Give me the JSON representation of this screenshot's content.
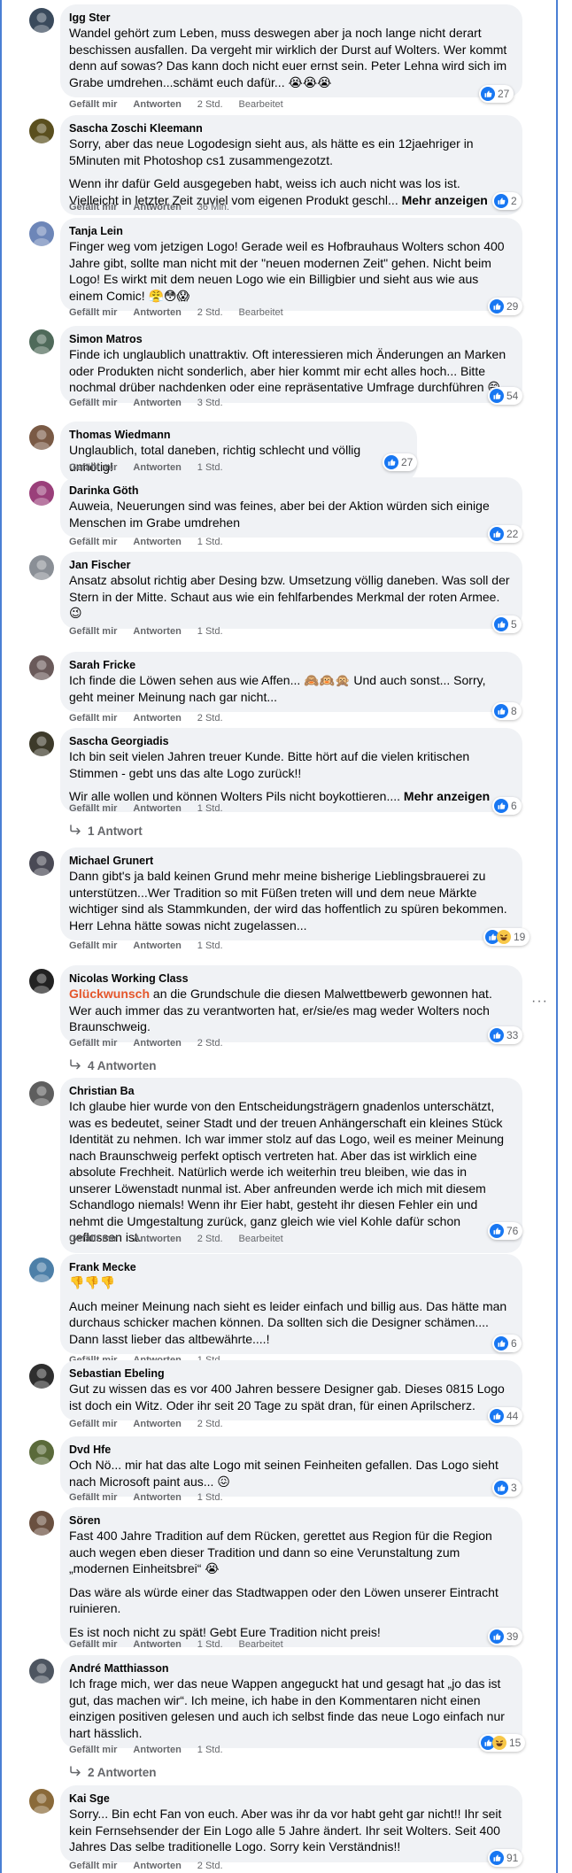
{
  "labels": {
    "like": "Gefällt mir",
    "reply": "Antworten",
    "edited": "Bearbeitet",
    "show_more": "Mehr anzeigen"
  },
  "comments": [
    {
      "name": "Igg Ster",
      "text": [
        "Wandel gehört zum Leben, muss deswegen aber ja noch lange nicht derart beschissen ausfallen. Da vergeht mir wirklich der Durst auf Wolters. Wer kommt denn auf sowas? Das kann doch nicht euer ernst sein. Peter Lehna wird sich im Grabe umdrehen...schämt euch dafür... 😭😭😭"
      ],
      "time": "2 Std.",
      "edited": true,
      "reactions": {
        "icons": [
          "like"
        ],
        "count": "27"
      }
    },
    {
      "name": "Sascha Zoschi Kleemann",
      "text": [
        "Sorry, aber das neue Logodesign sieht aus, als hätte es ein 12jaehriger in 5Minuten mit Photoshop cs1 zusammengezotzt.",
        "Wenn ihr dafür Geld ausgegeben habt, weiss ich auch nicht was los ist. Vielleicht in letzter Zeit zuviel vom eigenen Produkt geschl..."
      ],
      "has_more": true,
      "time": "36 Min.",
      "reactions": {
        "icons": [
          "like"
        ],
        "count": "2"
      }
    },
    {
      "name": "Tanja Lein",
      "text": [
        "Finger weg vom jetzigen Logo! Gerade weil es Hofbrauhaus Wolters schon 400 Jahre gibt, sollte man nicht mit der \"neuen modernen Zeit\" gehen. Nicht beim Logo! Es wirkt mit dem neuen Logo wie ein Billigbier und sieht aus wie aus einem Comic! 😤😳😱"
      ],
      "time": "2 Std.",
      "edited": true,
      "reactions": {
        "icons": [
          "like"
        ],
        "count": "29"
      }
    },
    {
      "name": "Simon Matros",
      "text": [
        "Finde ich unglaublich unattraktiv. Oft interessieren mich Änderungen an Marken oder Produkten nicht sonderlich, aber hier kommt mir echt alles hoch... Bitte nochmal drüber nachdenken oder eine repräsentative Umfrage durchführen 😄"
      ],
      "time": "3 Std.",
      "reactions": {
        "icons": [
          "like"
        ],
        "count": "54"
      }
    },
    {
      "name": "Thomas Wiedmann",
      "text": [
        "Unglaublich, total daneben, richtig schlecht und völlig unnötig!"
      ],
      "time": "1 Std.",
      "reactions": {
        "icons": [
          "like"
        ],
        "count": "27"
      }
    },
    {
      "name": "Darinka Göth",
      "text": [
        "Auweia, Neuerungen sind was feines, aber bei der Aktion würden sich einige Menschen im Grabe umdrehen"
      ],
      "time": "1 Std.",
      "reactions": {
        "icons": [
          "like"
        ],
        "count": "22"
      }
    },
    {
      "name": "Jan Fischer",
      "text": [
        "Ansatz absolut richtig aber Desing bzw. Umsetzung völlig daneben. Was soll der Stern in der Mitte. Schaut aus wie ein fehlfarbendes Merkmal der roten Armee. 😉"
      ],
      "time": "1 Std.",
      "reactions": {
        "icons": [
          "like"
        ],
        "count": "5"
      }
    },
    {
      "name": "Sarah Fricke",
      "text": [
        "Ich finde die Löwen sehen aus wie Affen... 🙈🙉🙊 Und auch sonst... Sorry, geht meiner Meinung nach gar nicht..."
      ],
      "time": "2 Std.",
      "reactions": {
        "icons": [
          "like"
        ],
        "count": "8"
      }
    },
    {
      "name": "Sascha Georgiadis",
      "text": [
        "Ich bin seit vielen Jahren treuer Kunde. Bitte hört auf die vielen kritischen Stimmen - gebt uns das alte Logo zurück!!",
        "Wir alle wollen und können Wolters Pils nicht boykottieren...."
      ],
      "has_more": true,
      "time": "1 Std.",
      "reactions": {
        "icons": [
          "like"
        ],
        "count": "6"
      },
      "replies": "1 Antwort"
    },
    {
      "name": "Michael Grunert",
      "text": [
        "Dann gibt's ja bald keinen Grund mehr meine bisherige Lieblingsbrauerei zu unterstützen...Wer Tradition so mit Füßen treten will und dem neue Märkte wichtiger sind als Stammkunden, der wird das hoffentlich zu spüren bekommen. Herr Lehna hätte sowas nicht zugelassen..."
      ],
      "time": "1 Std.",
      "reactions": {
        "icons": [
          "like",
          "haha"
        ],
        "count": "19"
      }
    },
    {
      "name": "Nicolas Working Class",
      "highlight": "Glückwunsch",
      "text": [
        " an die Grundschule die diesen Malwettbewerb gewonnen hat. Wer auch immer das zu verantworten hat, er/sie/es mag weder Wolters noch Braunschweig."
      ],
      "time": "2 Std.",
      "reactions": {
        "icons": [
          "like"
        ],
        "count": "33"
      },
      "replies": "4 Antworten"
    },
    {
      "name": "Christian Ba",
      "text": [
        "Ich glaube hier wurde von den Entscheidungsträgern gnadenlos unterschätzt, was es bedeutet, seiner Stadt und der treuen Anhängerschaft ein kleines Stück Identität zu nehmen. Ich war immer stolz auf das Logo, weil es meiner Meinung nach Braunschweig perfekt optisch vertreten hat. Aber das ist wirklich eine absolute Frechheit. Natürlich werde ich weiterhin treu bleiben, wie das in unserer Löwenstadt nunmal ist. Aber anfreunden werde ich mich mit diesem Schandlogo niemals! Wenn ihr Eier habt, gesteht ihr diesen Fehler ein und nehmt die Umgestaltung zurück, ganz gleich wie viel Kohle dafür schon geflossen ist."
      ],
      "time": "2 Std.",
      "edited": true,
      "reactions": {
        "icons": [
          "like"
        ],
        "count": "76"
      }
    },
    {
      "name": "Frank Mecke",
      "text": [
        "👎👎👎",
        "Auch meiner Meinung nach sieht es leider einfach und billig aus. Das hätte man durchaus schicker machen können. Da sollten sich die Designer schämen.... Dann lasst lieber das altbewährte....!"
      ],
      "time": "1 Std.",
      "reactions": {
        "icons": [
          "like"
        ],
        "count": "6"
      }
    },
    {
      "name": "Sebastian Ebeling",
      "text": [
        "Gut zu wissen das es vor 400 Jahren bessere Designer gab. Dieses 0815 Logo ist doch ein Witz. Oder ihr seit 20 Tage zu spät dran, für einen Aprilscherz."
      ],
      "time": "2 Std.",
      "reactions": {
        "icons": [
          "like"
        ],
        "count": "44"
      }
    },
    {
      "name": "Dvd Hfe",
      "text": [
        "Och Nö... mir hat das alte Logo mit seinen Feinheiten gefallen. Das Logo sieht nach Microsoft paint aus... 😖"
      ],
      "time": "1 Std.",
      "reactions": {
        "icons": [
          "like"
        ],
        "count": "3"
      }
    },
    {
      "name": "Sören",
      "text": [
        "Fast 400 Jahre Tradition auf dem Rücken, gerettet aus Region für die Region auch wegen eben dieser Tradition und dann so eine Verunstaltung zum „modernen Einheitsbrei“ 😭",
        "Das wäre als würde einer das Stadtwappen oder den Löwen unserer Eintracht ruinieren.",
        "Es ist noch nicht zu spät! Gebt Eure Tradition nicht preis!"
      ],
      "time": "1 Std.",
      "edited": true,
      "reactions": {
        "icons": [
          "like"
        ],
        "count": "39"
      }
    },
    {
      "name": "André Matthiasson",
      "text": [
        "Ich frage mich, wer das neue Wappen angeguckt hat und gesagt hat „jo das ist gut, das machen wir“. Ich meine, ich habe in den Kommentaren nicht einen einzigen positiven gelesen und auch ich selbst finde das neue Logo einfach nur hart hässlich."
      ],
      "time": "1 Std.",
      "reactions": {
        "icons": [
          "like",
          "haha"
        ],
        "count": "15"
      },
      "replies": "2 Antworten"
    },
    {
      "name": "Kai Sge",
      "text": [
        "Sorry... Bin echt Fan von euch. Aber was ihr da vor habt geht gar nicht!! Ihr seit kein Fernsehsender der Ein Logo alle 5 Jahre ändert. Ihr seit Wolters. Seit 400 Jahres Das selbe traditionelle Logo. Sorry kein Verständnis!!"
      ],
      "time": "2 Std.",
      "reactions": {
        "icons": [
          "like"
        ],
        "count": "91"
      }
    }
  ],
  "colors": {
    "bubble": "#f0f2f5",
    "meta": "#65676b",
    "like_blue": "#1877f2",
    "highlight": "#e4562b",
    "frame": "#4a7fd4"
  },
  "icons": {
    "like": "thumbs-up-icon",
    "haha": "haha-icon",
    "reply_arrow": "reply-arrow-icon",
    "more": "more-options-icon"
  },
  "more_options": "···"
}
